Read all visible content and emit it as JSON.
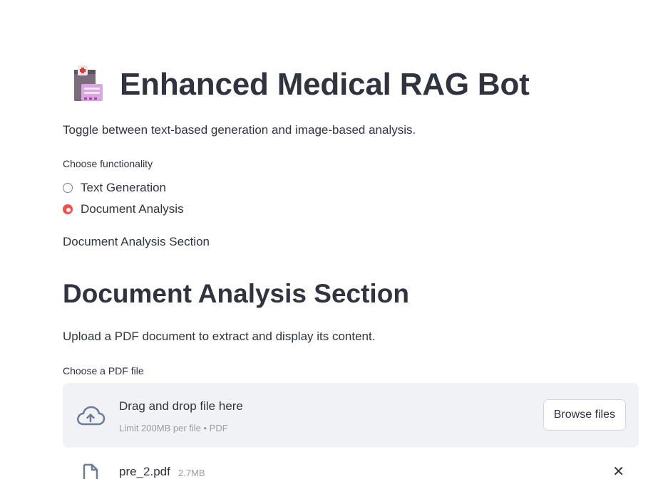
{
  "header": {
    "title": "Enhanced Medical RAG Bot",
    "icon": "medical-chart-icon",
    "description": "Toggle between text-based generation and image-based analysis."
  },
  "functionality": {
    "label": "Choose functionality",
    "options": [
      {
        "label": "Text Generation",
        "selected": false
      },
      {
        "label": "Document Analysis",
        "selected": true
      }
    ]
  },
  "section": {
    "caption": "Document Analysis Section",
    "title": "Document Analysis Section",
    "description": "Upload a PDF document to extract and display its content."
  },
  "uploader": {
    "label": "Choose a PDF file",
    "drop_text": "Drag and drop file here",
    "limit_text": "Limit 200MB per file • PDF",
    "browse_label": "Browse files",
    "icon": "cloud-upload-icon"
  },
  "uploaded_file": {
    "name": "pre_2.pdf",
    "size": "2.7MB",
    "remove_glyph": "✕"
  },
  "colors": {
    "accent": "#ff4b4b",
    "text": "#31333f",
    "dropzone_bg": "#f0f2f6",
    "muted": "#9a9ca6"
  }
}
